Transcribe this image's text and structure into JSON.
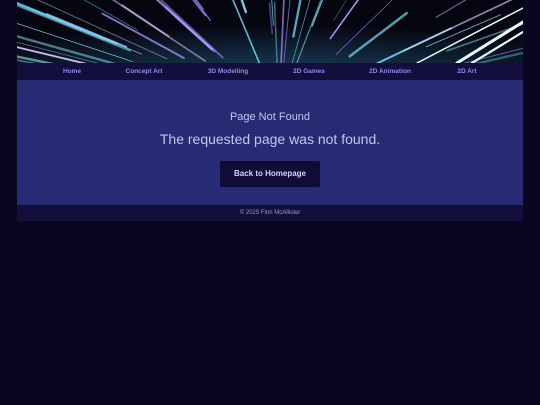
{
  "nav": {
    "items": [
      "Home",
      "Concept Art",
      "3D Modelling",
      "2D Games",
      "2D Animation",
      "2D Art"
    ]
  },
  "main": {
    "title": "Page Not Found",
    "message": "The requested page was not found.",
    "button_label": "Back to Homepage"
  },
  "footer": {
    "text": "© 2025 Finn McAllister"
  },
  "colors": {
    "page_bg": "#090720",
    "nav_bg": "#130f3c",
    "main_bg": "#272b73",
    "button_bg": "#110c37",
    "nav_text": "#8f8af0"
  }
}
